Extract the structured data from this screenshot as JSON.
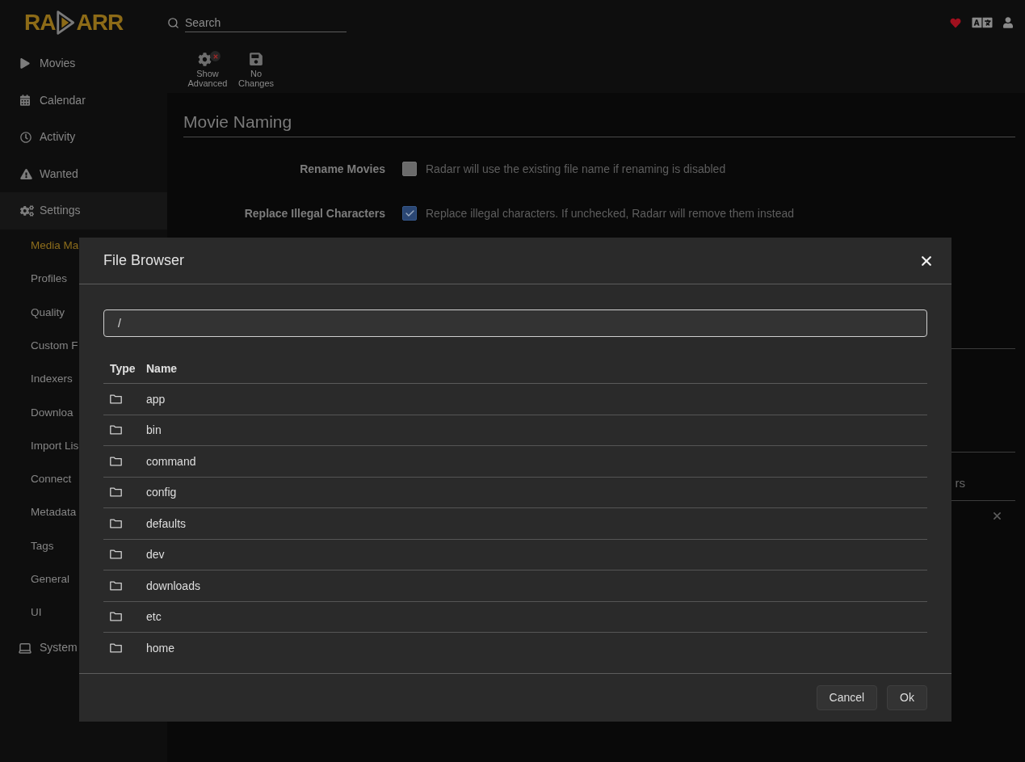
{
  "header": {
    "logo": {
      "left": "RA",
      "right": "ARR"
    },
    "search": {
      "placeholder": "Search"
    }
  },
  "sidebar": {
    "items": [
      {
        "label": "Movies",
        "selected": false
      },
      {
        "label": "Calendar",
        "selected": false
      },
      {
        "label": "Activity",
        "selected": false
      },
      {
        "label": "Wanted",
        "selected": false
      },
      {
        "label": "Settings",
        "selected": true,
        "children": [
          {
            "label": "Media Ma",
            "selected": true
          },
          {
            "label": "Profiles",
            "selected": false
          },
          {
            "label": "Quality",
            "selected": false
          },
          {
            "label": "Custom F",
            "selected": false
          },
          {
            "label": "Indexers",
            "selected": false
          },
          {
            "label": "Downloa",
            "selected": false
          },
          {
            "label": "Import Lis",
            "selected": false
          },
          {
            "label": "Connect",
            "selected": false
          },
          {
            "label": "Metadata",
            "selected": false
          },
          {
            "label": "Tags",
            "selected": false
          },
          {
            "label": "General",
            "selected": false
          },
          {
            "label": "UI",
            "selected": false
          }
        ]
      },
      {
        "label": "System",
        "selected": false
      }
    ]
  },
  "toolbar": {
    "buttons": [
      {
        "label": "Show Advanced"
      },
      {
        "label": "No Changes"
      }
    ]
  },
  "page": {
    "heading": "Movie Naming",
    "fields": [
      {
        "label": "Rename Movies",
        "checked": false,
        "help": "Radarr will use the existing file name if renaming is disabled"
      },
      {
        "label": "Replace Illegal Characters",
        "checked": true,
        "help": "Replace illegal characters. If unchecked, Radarr will remove them instead"
      }
    ],
    "text_fragment": "rs"
  },
  "modal": {
    "title": "File Browser",
    "path": {
      "value": "/"
    },
    "columns": [
      "Type",
      "Name"
    ],
    "rows": [
      {
        "name": "app"
      },
      {
        "name": "bin"
      },
      {
        "name": "command"
      },
      {
        "name": "config"
      },
      {
        "name": "defaults"
      },
      {
        "name": "dev"
      },
      {
        "name": "downloads"
      },
      {
        "name": "etc"
      },
      {
        "name": "home"
      }
    ],
    "buttons": [
      "Cancel",
      "Ok"
    ]
  }
}
